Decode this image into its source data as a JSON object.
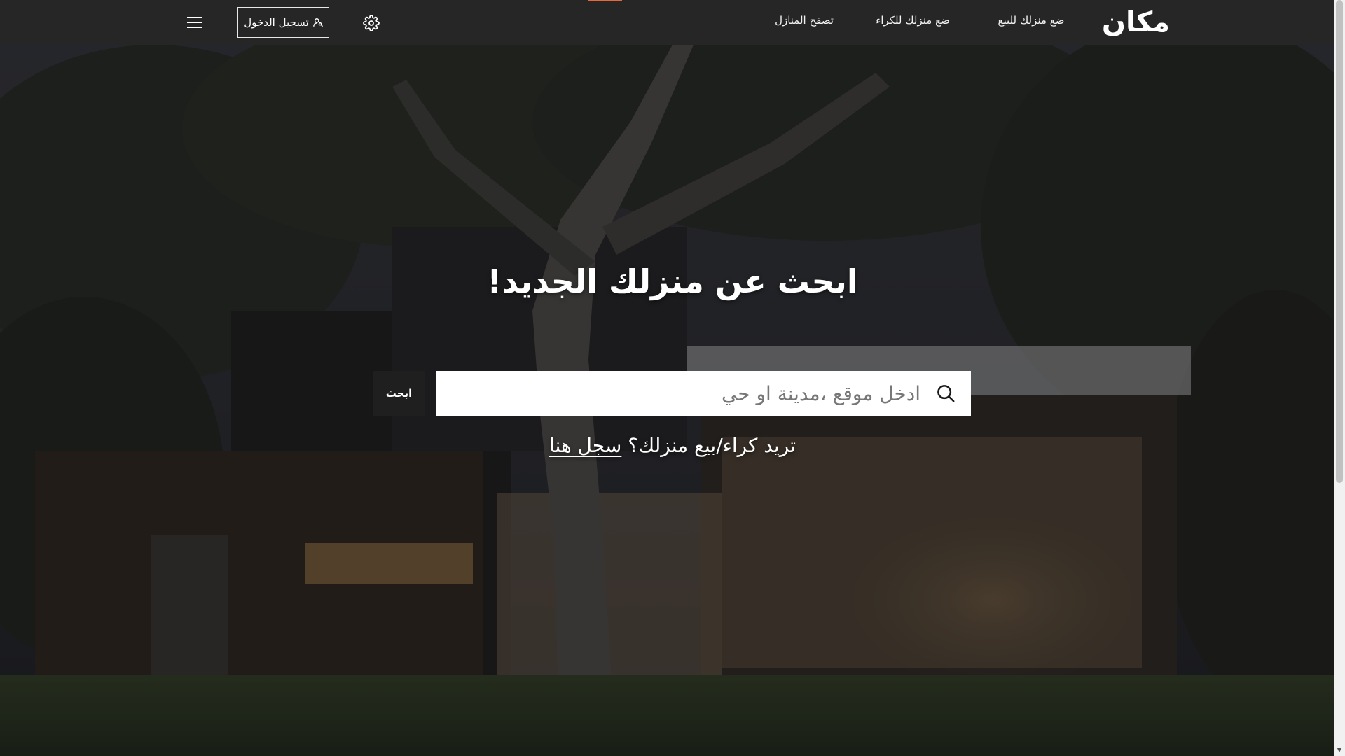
{
  "header": {
    "logo": "مكان",
    "nav": {
      "sell": "ضع منزلك للبيع",
      "rent": "ضع منزلك للكراء",
      "browse": "تصفح المنازل"
    },
    "settings_icon": "gear-icon",
    "login_label": "تسجيل الدخول",
    "login_icon": "user-key-icon",
    "menu_icon": "hamburger-menu-icon",
    "accent_color": "#e8673a",
    "background_color": "#262626"
  },
  "hero": {
    "background": "night-photo-modern-house-with-tree",
    "headline": "ابحث عن منزلك الجديد!",
    "search": {
      "placeholder": "ادخل موقع ،مدينة او حي",
      "value": "",
      "icon": "search-icon",
      "button_label": "ابحث"
    },
    "cta": {
      "text": "تريد كراء/بيع منزلك؟",
      "link_label": "سجل هنا"
    }
  }
}
